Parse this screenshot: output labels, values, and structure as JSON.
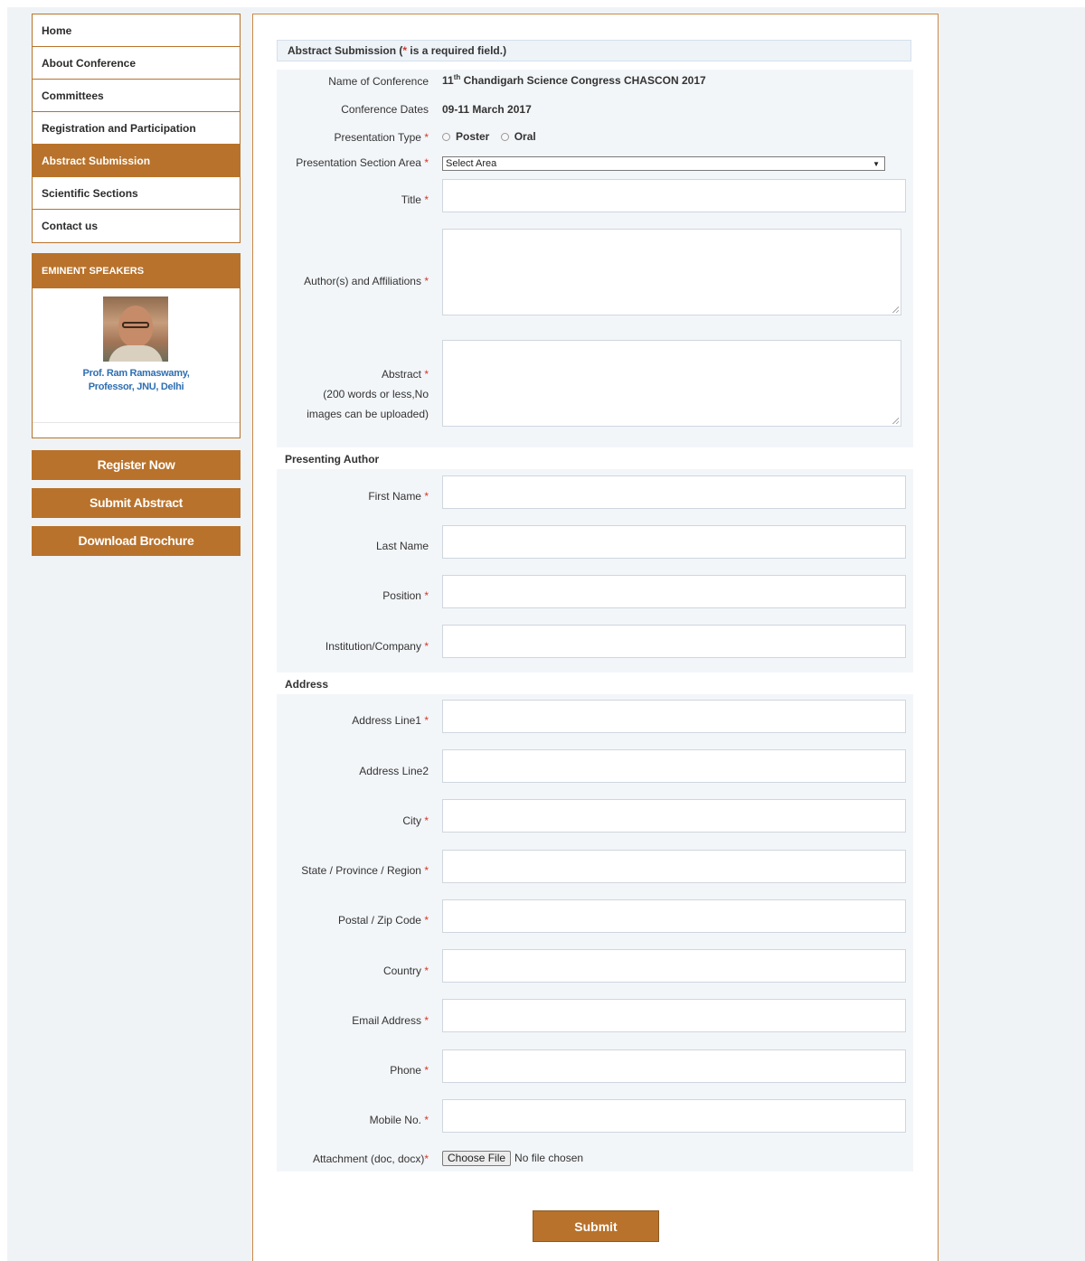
{
  "sidebar": {
    "menu": [
      {
        "label": "Home",
        "active": false
      },
      {
        "label": "About Conference",
        "active": false
      },
      {
        "label": "Committees",
        "active": false
      },
      {
        "label": "Registration and Participation",
        "active": false
      },
      {
        "label": "Abstract Submission",
        "active": true
      },
      {
        "label": "Scientific Sections",
        "active": false
      },
      {
        "label": "Contact us",
        "active": false
      }
    ],
    "speakers": {
      "title": "EMINENT SPEAKERS",
      "name_line1": "Prof. Ram Ramaswamy,",
      "name_line2": "Professor, JNU, Delhi"
    },
    "buttons": {
      "register": "Register Now",
      "submit_abstract": "Submit Abstract",
      "download_brochure": "Download Brochure"
    }
  },
  "form": {
    "header_title": "Abstract Submission (",
    "header_star": "*",
    "header_rest": " is a required field.)",
    "star": "*",
    "conference_label": "Name of Conference",
    "conference_prefix": "11",
    "conference_sup": "th",
    "conference_rest": " Chandigarh Science Congress CHASCON 2017",
    "dates_label": "Conference Dates",
    "dates_value": "09-11 March 2017",
    "presentation_type_label": "Presentation Type",
    "presentation_options": [
      "Poster",
      "Oral"
    ],
    "section_area_label": "Presentation Section Area",
    "section_area_value": "Select Area",
    "title_label": "Title",
    "authors_label": "Author(s) and Affiliations",
    "abstract_label": "Abstract",
    "abstract_note_line1": "(200 words or less,No",
    "abstract_note_line2": "images can be uploaded)",
    "presenting_author_title": "Presenting Author",
    "first_name_label": "First Name",
    "last_name_label": "Last Name",
    "position_label": "Position",
    "institution_label": "Institution/Company",
    "address_title": "Address",
    "address1_label": "Address Line1",
    "address2_label": "Address Line2",
    "city_label": "City",
    "state_label": "State / Province / Region",
    "postal_label": "Postal / Zip Code",
    "country_label": "Country",
    "email_label": "Email Address",
    "phone_label": "Phone",
    "mobile_label": "Mobile No.",
    "attachment_label": "Attachment (doc, docx)",
    "choose_file": "Choose File",
    "no_file": "No file chosen",
    "submit": "Submit"
  },
  "colors": {
    "accent": "#b8722b",
    "required": "#d0392b",
    "link": "#2e6fb2"
  }
}
